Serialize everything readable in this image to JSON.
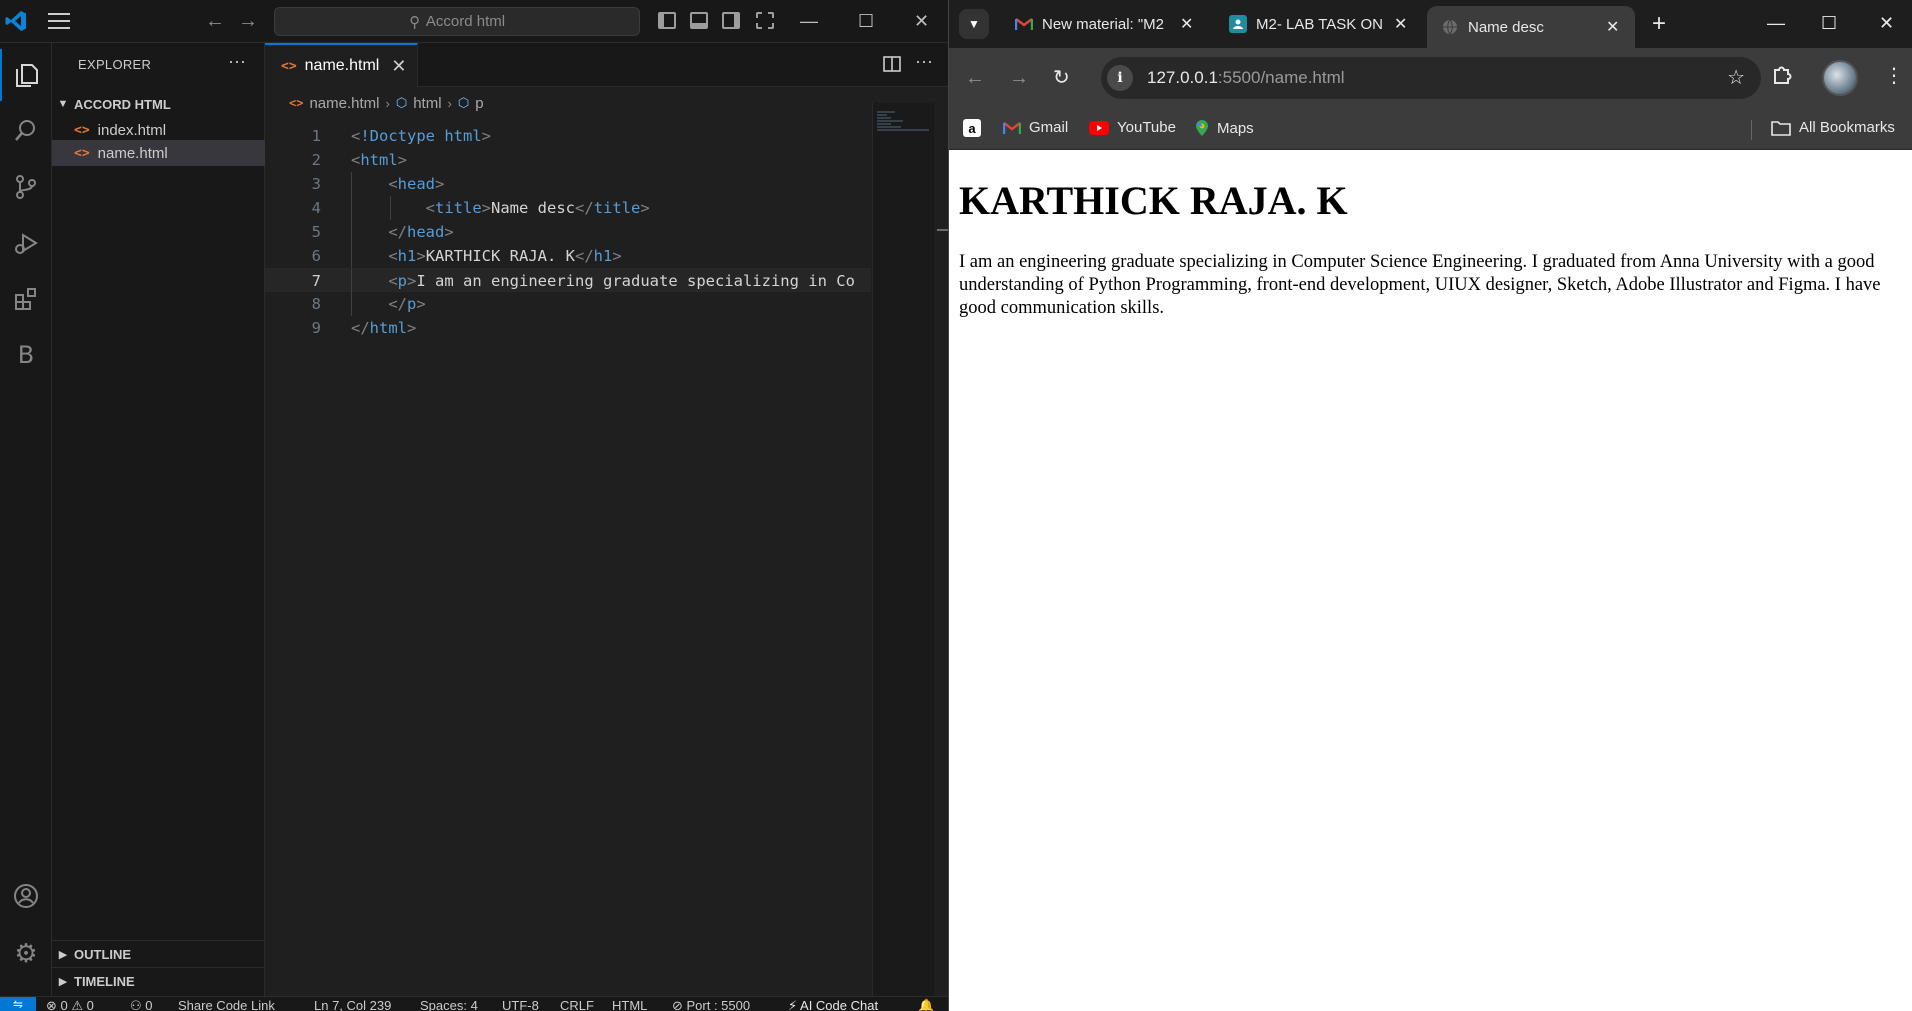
{
  "vscode": {
    "search_text": "Accord html",
    "explorer_title": "EXPLORER",
    "folder_name": "ACCORD HTML",
    "files": [
      {
        "name": "index.html",
        "selected": false
      },
      {
        "name": "name.html",
        "selected": true
      }
    ],
    "outline_label": "OUTLINE",
    "timeline_label": "TIMELINE",
    "active_tab": "name.html",
    "breadcrumb": [
      "name.html",
      "html",
      "p"
    ],
    "code_lines": [
      {
        "n": "1",
        "html": "<span class=\"br\">&lt;</span><span class=\"tag\">!Doctype</span> <span class=\"kw\">html</span><span class=\"br\">&gt;</span>"
      },
      {
        "n": "2",
        "html": "<span class=\"br\">&lt;</span><span class=\"tag\">html</span><span class=\"br\">&gt;</span>"
      },
      {
        "n": "3",
        "html": "    <span class=\"br\">&lt;</span><span class=\"tag\">head</span><span class=\"br\">&gt;</span>"
      },
      {
        "n": "4",
        "html": "        <span class=\"br\">&lt;</span><span class=\"tag\">title</span><span class=\"br\">&gt;</span><span class=\"txt\">Name desc</span><span class=\"br\">&lt;/</span><span class=\"tag\">title</span><span class=\"br\">&gt;</span>"
      },
      {
        "n": "5",
        "html": "    <span class=\"br\">&lt;/</span><span class=\"tag\">head</span><span class=\"br\">&gt;</span>"
      },
      {
        "n": "6",
        "html": "    <span class=\"br\">&lt;</span><span class=\"tag\">h1</span><span class=\"br\">&gt;</span><span class=\"txt\">KARTHICK RAJA. K</span><span class=\"br\">&lt;/</span><span class=\"tag\">h1</span><span class=\"br\">&gt;</span>"
      },
      {
        "n": "7",
        "html": "    <span class=\"br\">&lt;</span><span class=\"tag\">p</span><span class=\"br\">&gt;</span><span class=\"txt\">I am an engineering graduate specializing in Co</span>"
      },
      {
        "n": "8",
        "html": "    <span class=\"br\">&lt;/</span><span class=\"tag\">p</span><span class=\"br\">&gt;</span>"
      },
      {
        "n": "9",
        "html": "<span class=\"br\">&lt;/</span><span class=\"tag\">html</span><span class=\"br\">&gt;</span>"
      }
    ],
    "current_line": "7",
    "status": {
      "problems": "⊗ 0 ⚠ 0",
      "ports": "⚇ 0",
      "share": "Share Code Link",
      "position": "Ln 7, Col 239",
      "spaces": "Spaces: 4",
      "encoding": "UTF-8",
      "eol": "CRLF",
      "language": "HTML",
      "port": "⊘ Port : 5500",
      "ai": "⚡ AI Code Chat"
    }
  },
  "chrome": {
    "tabs": [
      {
        "title": "New material: \"M2",
        "favicon": "gmail-icon",
        "active": false
      },
      {
        "title": "M2- LAB TASK ON",
        "favicon": "classroom-icon",
        "active": false
      },
      {
        "title": "Name desc",
        "favicon": "globe-icon",
        "active": true
      }
    ],
    "url_host": "127.0.0.1",
    "url_path": ":5500/name.html",
    "bookmarks": [
      "Gmail",
      "YouTube",
      "Maps"
    ],
    "all_bookmarks": "All Bookmarks"
  },
  "page": {
    "heading": "KARTHICK RAJA. K",
    "paragraph": "I am an engineering graduate specializing in Computer Science Engineering. I graduated from Anna University with a good understanding of Python Programming, front-end development, UIUX designer, Sketch, Adobe Illustrator and Figma. I have good communication skills."
  },
  "colors": {
    "accent": "#0078d4",
    "html_icon": "#e37933",
    "tag": "#569cd6"
  }
}
